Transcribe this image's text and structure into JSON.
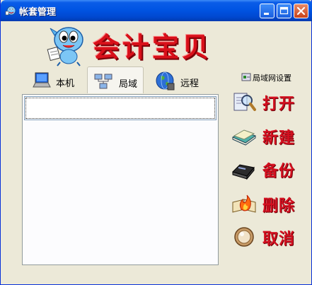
{
  "window": {
    "title": "帐套管理"
  },
  "logo": {
    "text": "会计宝贝"
  },
  "tabs": [
    {
      "label": "本机",
      "icon": "laptop-icon",
      "active": false
    },
    {
      "label": "局域",
      "icon": "network-icon",
      "active": true
    },
    {
      "label": "远程",
      "icon": "globe-icon",
      "active": false
    }
  ],
  "list": {
    "items": []
  },
  "lan_settings": {
    "label": "局域网设置",
    "icon": "network-settings-icon"
  },
  "actions": [
    {
      "label": "打开",
      "icon": "magnifier-open-icon"
    },
    {
      "label": "新建",
      "icon": "new-book-icon"
    },
    {
      "label": "备份",
      "icon": "disk-backup-icon"
    },
    {
      "label": "删除",
      "icon": "book-fire-icon"
    },
    {
      "label": "取消",
      "icon": "cancel-circle-icon"
    }
  ],
  "colors": {
    "titlebar": "#0054e3",
    "window_bg": "#ece9d8",
    "accent_red": "#d41020"
  }
}
